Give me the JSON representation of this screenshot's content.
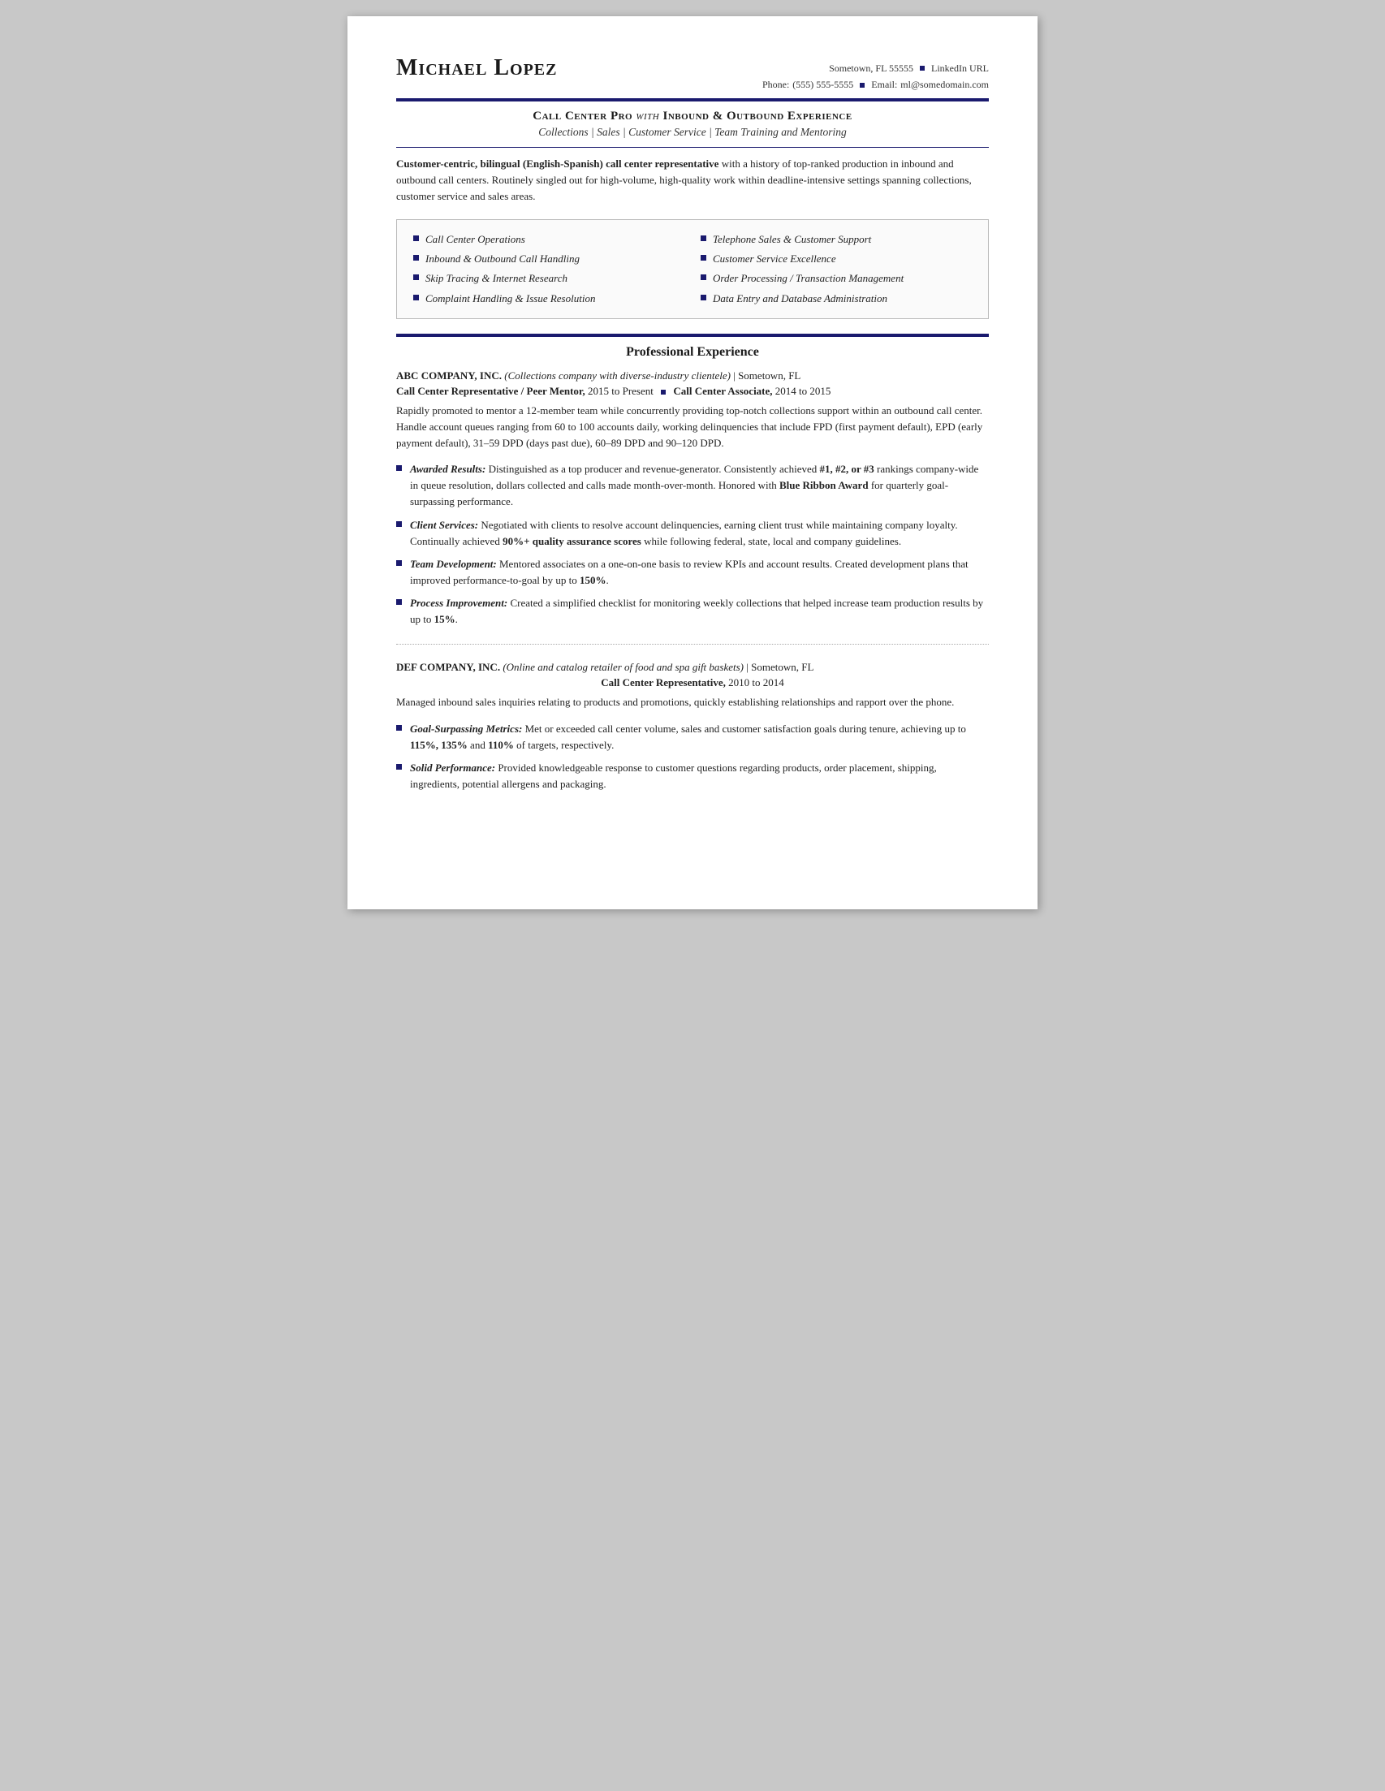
{
  "header": {
    "name": "Michael Lopez",
    "contact": {
      "line1": "Sometown, FL 55555",
      "linkedin": "LinkedIn URL",
      "phone_label": "Phone:",
      "phone": "(555) 555-5555",
      "email_label": "Email:",
      "email": "ml@somedomain.com"
    }
  },
  "headline": {
    "title_bold": "Call Center Pro",
    "title_italic": "with",
    "title_bold2": "Inbound & Outbound Experience",
    "subtitle": "Collections | Sales | Customer Service | Team Training and Mentoring"
  },
  "summary": {
    "bold_lead": "Customer-centric, bilingual (English-Spanish) call center representative",
    "body": " with a history of top-ranked production in inbound and outbound call centers. Routinely singled out for high-volume, high-quality work within deadline-intensive settings spanning collections, customer service and sales areas."
  },
  "skills": [
    "Call Center Operations",
    "Telephone Sales & Customer Support",
    "Inbound & Outbound Call Handling",
    "Customer Service Excellence",
    "Skip Tracing & Internet Research",
    "Order Processing / Transaction Management",
    "Complaint Handling & Issue Resolution",
    "Data Entry and Database Administration"
  ],
  "sections": {
    "experience_title": "Professional Experience",
    "jobs": [
      {
        "company": "ABC COMPANY, INC.",
        "desc": "(Collections company with diverse-industry clientele)",
        "location": "Sometown, FL",
        "roles": [
          {
            "title": "Call Center Representative / Peer Mentor,",
            "dates": "2015 to Present",
            "separator": true,
            "title2": "Call Center Associate,",
            "dates2": "2014 to 2015"
          }
        ],
        "summary": "Rapidly promoted to mentor a 12-member team while concurrently providing top-notch collections support within an outbound call center. Handle account queues ranging from 60 to 100 accounts daily, working delinquencies that include FPD (first payment default), EPD (early payment default), 31–59 DPD (days past due), 60–89 DPD and 90–120 DPD.",
        "bullets": [
          {
            "lead_italic_bold": "Awarded Results:",
            "text": " Distinguished as a top producer and revenue-generator. Consistently achieved ",
            "bold_inline": "#1, #2, or #3",
            "text2": " rankings company-wide in queue resolution, dollars collected and calls made month-over-month. Honored with ",
            "bold_inline2": "Blue Ribbon Award",
            "text3": " for quarterly goal-surpassing performance."
          },
          {
            "lead_italic_bold": "Client Services:",
            "text": " Negotiated with clients to resolve account delinquencies, earning client trust while maintaining company loyalty. Continually achieved ",
            "bold_inline": "90%+ quality assurance scores",
            "text2": " while following federal, state, local and company guidelines.",
            "text3": ""
          },
          {
            "lead_italic_bold": "Team Development:",
            "text": " Mentored associates on a one-on-one basis to review KPIs and account results. Created development plans that improved performance-to-goal by up to ",
            "bold_inline": "150%",
            "text2": ".",
            "text3": ""
          },
          {
            "lead_italic_bold": "Process Improvement:",
            "text": " Created a simplified checklist for monitoring weekly collections that helped increase team production results by up to ",
            "bold_inline": "15%",
            "text2": ".",
            "text3": ""
          }
        ]
      },
      {
        "company": "DEF COMPANY, INC.",
        "desc": "(Online and catalog retailer of food and spa gift baskets)",
        "location": "Sometown, FL",
        "roles": [
          {
            "title": "Call Center Representative,",
            "dates": "2010 to 2014",
            "separator": false
          }
        ],
        "summary": "Managed inbound sales inquiries relating to products and promotions, quickly establishing relationships and rapport over the phone.",
        "bullets": [
          {
            "lead_italic_bold": "Goal-Surpassing Metrics:",
            "text": " Met or exceeded call center volume, sales and customer satisfaction goals during tenure, achieving up to ",
            "bold_inline": "115%, 135%",
            "text2": " and ",
            "bold_inline2": "110%",
            "text3": " of targets, respectively."
          },
          {
            "lead_italic_bold": "Solid Performance:",
            "text": " Provided knowledgeable response to customer questions regarding products, order placement, shipping, ingredients, potential allergens and packaging.",
            "bold_inline": "",
            "text2": "",
            "text3": ""
          }
        ]
      }
    ]
  }
}
